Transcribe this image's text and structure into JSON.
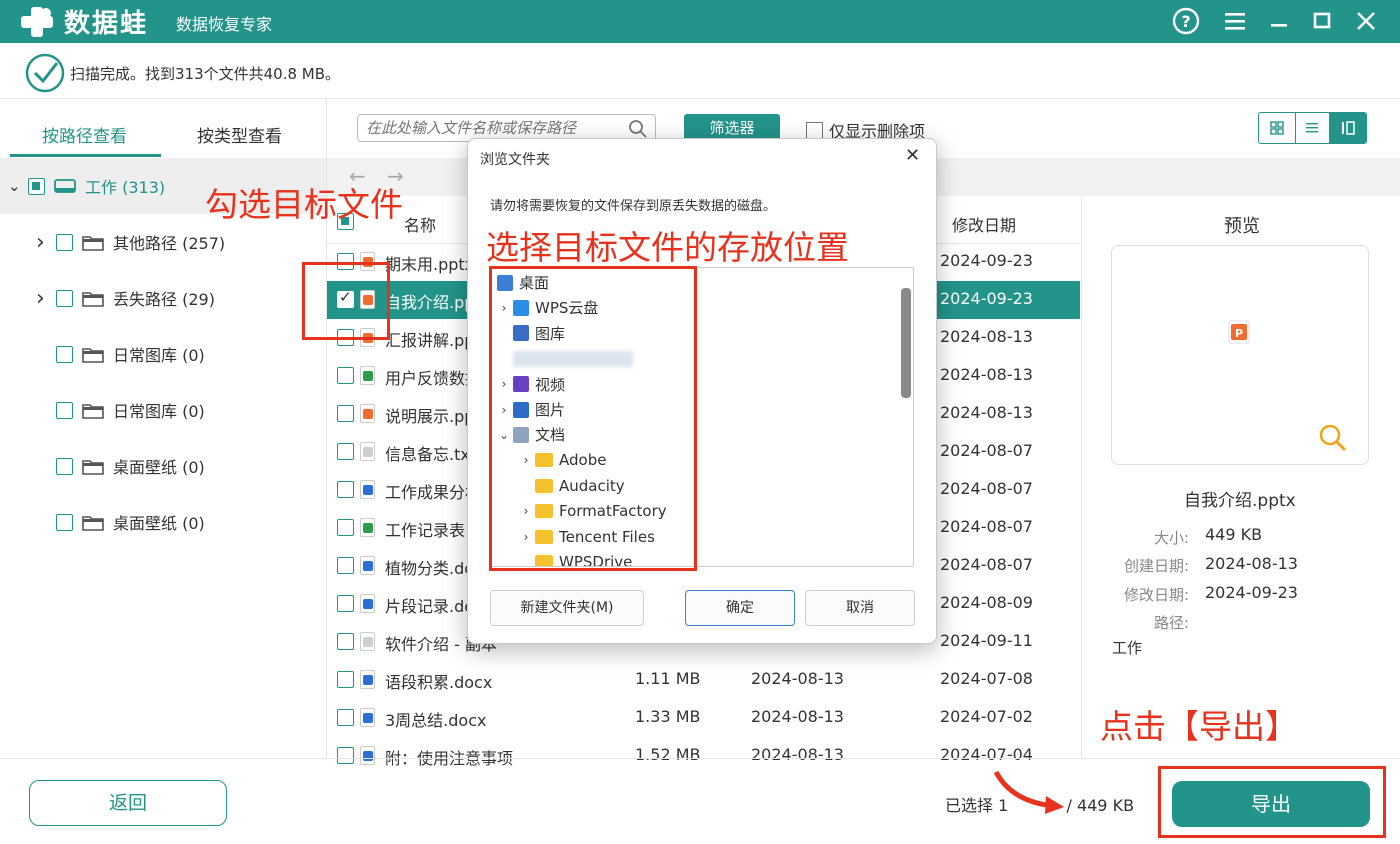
{
  "app": {
    "name": "数据蛙",
    "subtitle": "数据恢复专家",
    "icons": [
      "help-icon",
      "menu-icon",
      "minimize-icon",
      "maximize-icon",
      "close-icon"
    ]
  },
  "status": {
    "text": "扫描完成。找到313个文件共40.8 MB。"
  },
  "tabs": {
    "by_path": "按路径查看",
    "by_type": "按类型查看"
  },
  "tree": {
    "root": "工作 (313)",
    "items": [
      {
        "label": "其他路径 (257)",
        "expandable": true
      },
      {
        "label": "丢失路径 (29)",
        "expandable": true
      },
      {
        "label": "日常图库 (0)",
        "expandable": false
      },
      {
        "label": "日常图库 (0)",
        "expandable": false
      },
      {
        "label": "桌面壁纸 (0)",
        "expandable": false
      },
      {
        "label": "桌面壁纸 (0)",
        "expandable": false
      }
    ]
  },
  "search": {
    "placeholder": "在此处输入文件名称或保存路径"
  },
  "filter_label": "筛选器",
  "only_deleted_label": "仅显示删除项",
  "list": {
    "col_name": "名称",
    "col_modified": "修改日期",
    "rows": [
      {
        "name": "期末用.pptx",
        "size": "",
        "created": "",
        "modified": "2024-09-23",
        "icon": "ppt",
        "checked": false,
        "selected": false
      },
      {
        "name": "自我介绍.pptx",
        "size": "",
        "created": "",
        "modified": "2024-09-23",
        "icon": "ppt",
        "checked": true,
        "selected": true
      },
      {
        "name": "汇报讲解.pptx",
        "size": "",
        "created": "",
        "modified": "2024-08-13",
        "icon": "ppt",
        "checked": false,
        "selected": false
      },
      {
        "name": "用户反馈数据",
        "size": "",
        "created": "",
        "modified": "2024-08-13",
        "icon": "xls",
        "checked": false,
        "selected": false
      },
      {
        "name": "说明展示.pptx",
        "size": "",
        "created": "",
        "modified": "2024-08-13",
        "icon": "ppt",
        "checked": false,
        "selected": false
      },
      {
        "name": "信息备忘.txt",
        "size": "",
        "created": "",
        "modified": "2024-08-07",
        "icon": "txt",
        "checked": false,
        "selected": false
      },
      {
        "name": "工作成果分析",
        "size": "",
        "created": "",
        "modified": "2024-08-07",
        "icon": "doc",
        "checked": false,
        "selected": false
      },
      {
        "name": "工作记录表",
        "size": "",
        "created": "",
        "modified": "2024-08-07",
        "icon": "xls",
        "checked": false,
        "selected": false
      },
      {
        "name": "植物分类.docx",
        "size": "",
        "created": "",
        "modified": "2024-08-07",
        "icon": "doc",
        "checked": false,
        "selected": false
      },
      {
        "name": "片段记录.docx",
        "size": "",
        "created": "",
        "modified": "2024-08-09",
        "icon": "doc",
        "checked": false,
        "selected": false
      },
      {
        "name": "软件介绍 - 副本",
        "size": "",
        "created": "",
        "modified": "2024-09-11",
        "icon": "txt",
        "checked": false,
        "selected": false
      },
      {
        "name": "语段积累.docx",
        "size": "1.11 MB",
        "created": "2024-08-13",
        "modified": "2024-07-08",
        "icon": "doc",
        "checked": false,
        "selected": false
      },
      {
        "name": "3周总结.docx",
        "size": "1.33 MB",
        "created": "2024-08-13",
        "modified": "2024-07-02",
        "icon": "doc",
        "checked": false,
        "selected": false
      },
      {
        "name": "附：使用注意事项",
        "size": "1.52 MB",
        "created": "2024-08-13",
        "modified": "2024-07-04",
        "icon": "doc",
        "checked": false,
        "selected": false
      }
    ]
  },
  "preview": {
    "title": "预览",
    "filename": "自我介绍.pptx",
    "size_label": "大小:",
    "size": "449 KB",
    "created_label": "创建日期:",
    "created": "2024-08-13",
    "modified_label": "修改日期:",
    "modified": "2024-09-23",
    "path_label": "路径:",
    "path": "工作"
  },
  "dialog": {
    "title": "浏览文件夹",
    "message": "请勿将需要恢复的文件保存到原丢失数据的磁盘。",
    "tree": [
      {
        "label": "桌面",
        "level": 0,
        "caret": "",
        "icon": "desktop"
      },
      {
        "label": "WPS云盘",
        "level": 1,
        "caret": "›",
        "icon": "cloud"
      },
      {
        "label": "图库",
        "level": 1,
        "caret": "",
        "icon": "gallery"
      },
      {
        "label": "",
        "level": 1,
        "caret": "",
        "icon": "blurred"
      },
      {
        "label": "视频",
        "level": 1,
        "caret": "›",
        "icon": "video"
      },
      {
        "label": "图片",
        "level": 1,
        "caret": "›",
        "icon": "picture"
      },
      {
        "label": "文档",
        "level": 1,
        "caret": "⌄",
        "icon": "documents"
      },
      {
        "label": "Adobe",
        "level": 2,
        "caret": "›",
        "icon": "folder"
      },
      {
        "label": "Audacity",
        "level": 2,
        "caret": "",
        "icon": "folder"
      },
      {
        "label": "FormatFactory",
        "level": 2,
        "caret": "›",
        "icon": "folder"
      },
      {
        "label": "Tencent Files",
        "level": 2,
        "caret": "›",
        "icon": "folder"
      },
      {
        "label": "WPSDrive",
        "level": 2,
        "caret": "",
        "icon": "folder"
      }
    ],
    "new_folder": "新建文件夹(M)",
    "ok": "确定",
    "cancel": "取消"
  },
  "annotations": {
    "check_target": "勾选目标文件",
    "choose_location": "选择目标文件的存放位置",
    "click_export": "点击【导出】",
    "color": "#e8321e"
  },
  "bottom": {
    "back": "返回",
    "selected_prefix": "已选择 1",
    "selected_suffix": "/ 449 KB",
    "export": "导出"
  },
  "colors": {
    "accent": "#23948a",
    "annotation": "#e8321e"
  }
}
